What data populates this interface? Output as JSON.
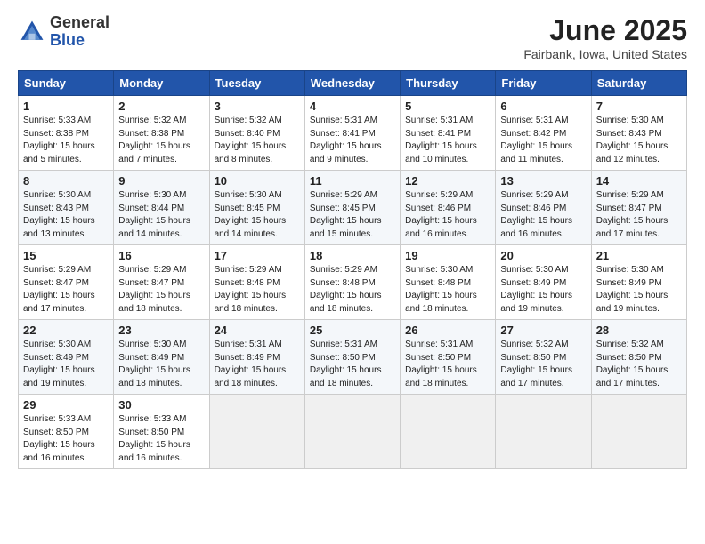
{
  "logo": {
    "general": "General",
    "blue": "Blue"
  },
  "title": "June 2025",
  "subtitle": "Fairbank, Iowa, United States",
  "days_of_week": [
    "Sunday",
    "Monday",
    "Tuesday",
    "Wednesday",
    "Thursday",
    "Friday",
    "Saturday"
  ],
  "weeks": [
    [
      {
        "day": "1",
        "sunrise": "5:33 AM",
        "sunset": "8:38 PM",
        "daylight": "15 hours and 5 minutes."
      },
      {
        "day": "2",
        "sunrise": "5:32 AM",
        "sunset": "8:38 PM",
        "daylight": "15 hours and 7 minutes."
      },
      {
        "day": "3",
        "sunrise": "5:32 AM",
        "sunset": "8:40 PM",
        "daylight": "15 hours and 8 minutes."
      },
      {
        "day": "4",
        "sunrise": "5:31 AM",
        "sunset": "8:41 PM",
        "daylight": "15 hours and 9 minutes."
      },
      {
        "day": "5",
        "sunrise": "5:31 AM",
        "sunset": "8:41 PM",
        "daylight": "15 hours and 10 minutes."
      },
      {
        "day": "6",
        "sunrise": "5:31 AM",
        "sunset": "8:42 PM",
        "daylight": "15 hours and 11 minutes."
      },
      {
        "day": "7",
        "sunrise": "5:30 AM",
        "sunset": "8:43 PM",
        "daylight": "15 hours and 12 minutes."
      }
    ],
    [
      {
        "day": "8",
        "sunrise": "5:30 AM",
        "sunset": "8:43 PM",
        "daylight": "15 hours and 13 minutes."
      },
      {
        "day": "9",
        "sunrise": "5:30 AM",
        "sunset": "8:44 PM",
        "daylight": "15 hours and 14 minutes."
      },
      {
        "day": "10",
        "sunrise": "5:30 AM",
        "sunset": "8:45 PM",
        "daylight": "15 hours and 14 minutes."
      },
      {
        "day": "11",
        "sunrise": "5:29 AM",
        "sunset": "8:45 PM",
        "daylight": "15 hours and 15 minutes."
      },
      {
        "day": "12",
        "sunrise": "5:29 AM",
        "sunset": "8:46 PM",
        "daylight": "15 hours and 16 minutes."
      },
      {
        "day": "13",
        "sunrise": "5:29 AM",
        "sunset": "8:46 PM",
        "daylight": "15 hours and 16 minutes."
      },
      {
        "day": "14",
        "sunrise": "5:29 AM",
        "sunset": "8:47 PM",
        "daylight": "15 hours and 17 minutes."
      }
    ],
    [
      {
        "day": "15",
        "sunrise": "5:29 AM",
        "sunset": "8:47 PM",
        "daylight": "15 hours and 17 minutes."
      },
      {
        "day": "16",
        "sunrise": "5:29 AM",
        "sunset": "8:47 PM",
        "daylight": "15 hours and 18 minutes."
      },
      {
        "day": "17",
        "sunrise": "5:29 AM",
        "sunset": "8:48 PM",
        "daylight": "15 hours and 18 minutes."
      },
      {
        "day": "18",
        "sunrise": "5:29 AM",
        "sunset": "8:48 PM",
        "daylight": "15 hours and 18 minutes."
      },
      {
        "day": "19",
        "sunrise": "5:30 AM",
        "sunset": "8:48 PM",
        "daylight": "15 hours and 18 minutes."
      },
      {
        "day": "20",
        "sunrise": "5:30 AM",
        "sunset": "8:49 PM",
        "daylight": "15 hours and 19 minutes."
      },
      {
        "day": "21",
        "sunrise": "5:30 AM",
        "sunset": "8:49 PM",
        "daylight": "15 hours and 19 minutes."
      }
    ],
    [
      {
        "day": "22",
        "sunrise": "5:30 AM",
        "sunset": "8:49 PM",
        "daylight": "15 hours and 19 minutes."
      },
      {
        "day": "23",
        "sunrise": "5:30 AM",
        "sunset": "8:49 PM",
        "daylight": "15 hours and 18 minutes."
      },
      {
        "day": "24",
        "sunrise": "5:31 AM",
        "sunset": "8:49 PM",
        "daylight": "15 hours and 18 minutes."
      },
      {
        "day": "25",
        "sunrise": "5:31 AM",
        "sunset": "8:50 PM",
        "daylight": "15 hours and 18 minutes."
      },
      {
        "day": "26",
        "sunrise": "5:31 AM",
        "sunset": "8:50 PM",
        "daylight": "15 hours and 18 minutes."
      },
      {
        "day": "27",
        "sunrise": "5:32 AM",
        "sunset": "8:50 PM",
        "daylight": "15 hours and 17 minutes."
      },
      {
        "day": "28",
        "sunrise": "5:32 AM",
        "sunset": "8:50 PM",
        "daylight": "15 hours and 17 minutes."
      }
    ],
    [
      {
        "day": "29",
        "sunrise": "5:33 AM",
        "sunset": "8:50 PM",
        "daylight": "15 hours and 16 minutes."
      },
      {
        "day": "30",
        "sunrise": "5:33 AM",
        "sunset": "8:50 PM",
        "daylight": "15 hours and 16 minutes."
      },
      null,
      null,
      null,
      null,
      null
    ]
  ]
}
